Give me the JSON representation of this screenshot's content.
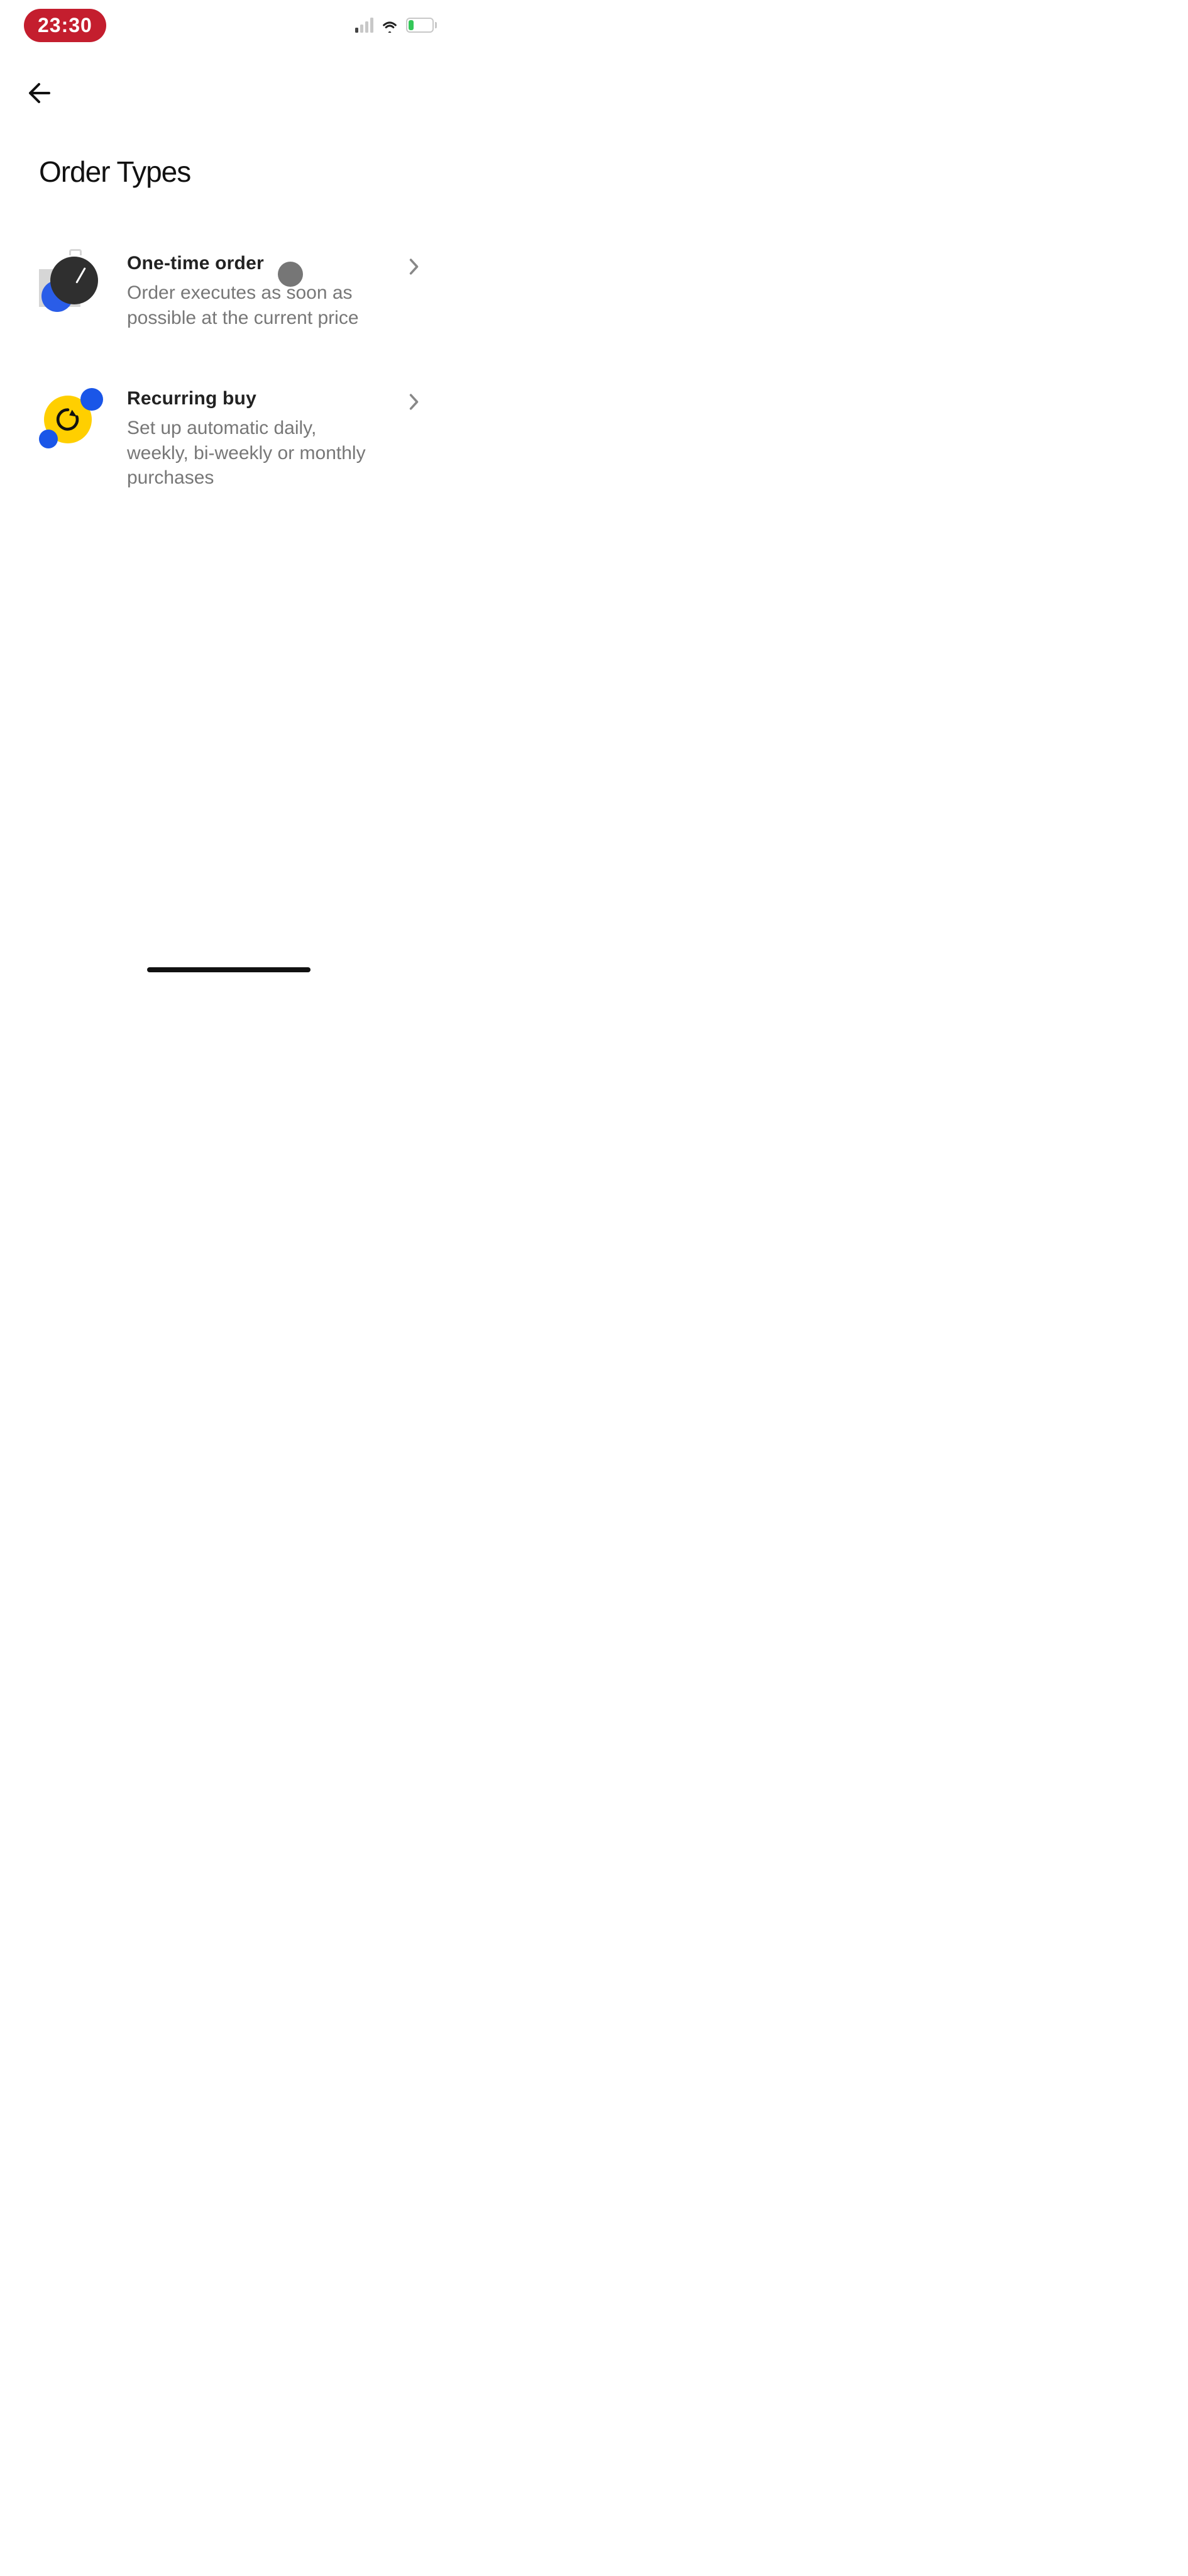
{
  "status_bar": {
    "time": "23:30",
    "battery_percent": "22"
  },
  "header": {
    "title": "Order Types"
  },
  "options": [
    {
      "title": "One-time order",
      "description": "Order executes as soon as possible at the current price"
    },
    {
      "title": "Recurring buy",
      "description": "Set up automatic daily, weekly, bi-weekly or monthly purchases"
    }
  ]
}
